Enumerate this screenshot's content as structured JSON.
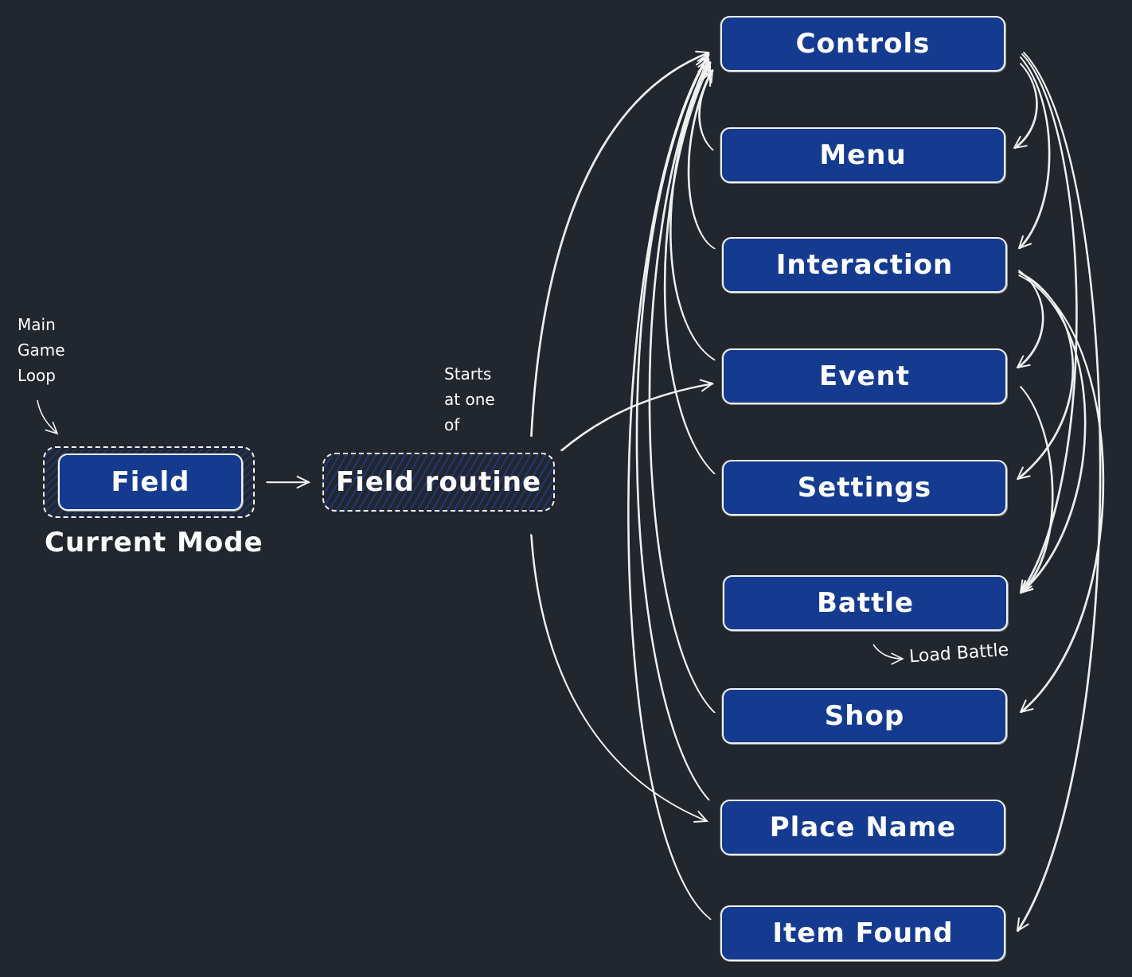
{
  "diagram": {
    "title_note": "Main\nGame\nLoop",
    "current_mode": {
      "label": "Field",
      "caption": "Current Mode"
    },
    "routine": {
      "label": "Field routine",
      "note": "Starts\nat one\nof"
    },
    "nodes": [
      {
        "id": "controls",
        "label": "Controls"
      },
      {
        "id": "menu",
        "label": "Menu"
      },
      {
        "id": "interaction",
        "label": "Interaction"
      },
      {
        "id": "event",
        "label": "Event"
      },
      {
        "id": "settings",
        "label": "Settings"
      },
      {
        "id": "battle",
        "label": "Battle"
      },
      {
        "id": "shop",
        "label": "Shop"
      },
      {
        "id": "place-name",
        "label": "Place Name"
      },
      {
        "id": "item-found",
        "label": "Item Found"
      }
    ],
    "battle_note": "Load Battle",
    "edges": [
      {
        "from": "field",
        "to": "field-routine"
      },
      {
        "from": "field-routine",
        "to": "controls"
      },
      {
        "from": "field-routine",
        "to": "event"
      },
      {
        "from": "field-routine",
        "to": "place-name"
      },
      {
        "from": "menu",
        "to": "controls"
      },
      {
        "from": "interaction",
        "to": "controls"
      },
      {
        "from": "event",
        "to": "controls"
      },
      {
        "from": "settings",
        "to": "controls"
      },
      {
        "from": "shop",
        "to": "controls"
      },
      {
        "from": "place-name",
        "to": "controls"
      },
      {
        "from": "item-found",
        "to": "controls"
      },
      {
        "from": "controls",
        "to": "menu"
      },
      {
        "from": "controls",
        "to": "interaction"
      },
      {
        "from": "controls",
        "to": "battle"
      },
      {
        "from": "controls",
        "to": "item-found"
      },
      {
        "from": "interaction",
        "to": "event"
      },
      {
        "from": "interaction",
        "to": "settings"
      },
      {
        "from": "interaction",
        "to": "battle"
      },
      {
        "from": "interaction",
        "to": "shop"
      },
      {
        "from": "event",
        "to": "battle"
      }
    ],
    "colors": {
      "background": "#22262e",
      "node_fill": "#153b91",
      "stroke": "#f2f2f2"
    }
  }
}
